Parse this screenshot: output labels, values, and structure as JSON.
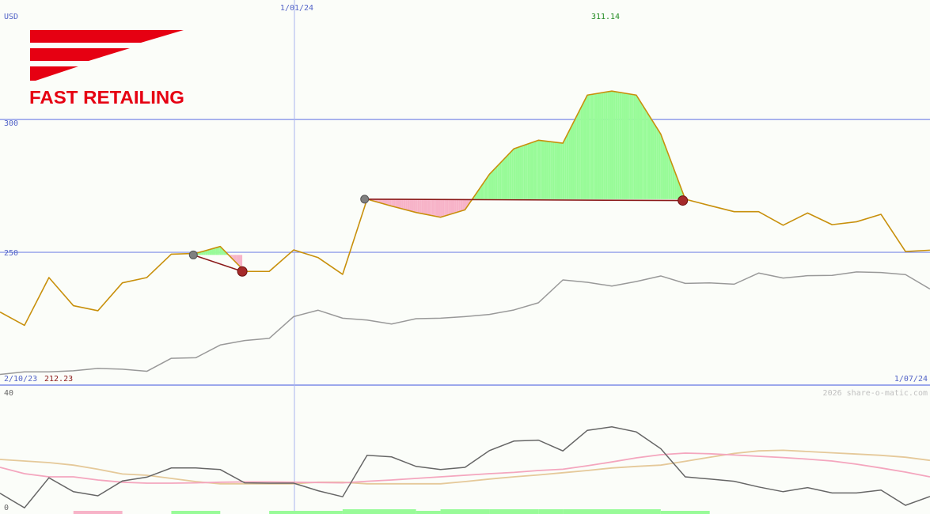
{
  "brand": {
    "name": "FAST RETAILING",
    "color": "#e60012"
  },
  "header": {
    "currency": "USD",
    "date_marker": "1/01/24",
    "high_value": "311.14"
  },
  "footer": {
    "start_date": "2/10/23",
    "low_value": "212.23",
    "end_date": "1/07/24",
    "copyright": "2026 share-o-matic.com"
  },
  "colors": {
    "price_line": "#c8900c",
    "index_line": "#999999",
    "gain_fill": "#98fb98",
    "loss_fill": "#f7b3c8",
    "trade_line": "#8b1a1a",
    "grid": "#7c8ce8",
    "high_label": "#228b22",
    "low_label": "#8b1a1a",
    "osc_main": "#666666",
    "osc_fast": "#f4a6be",
    "osc_slow": "#e5c99a"
  },
  "chart_data": [
    {
      "type": "line",
      "title": "",
      "ylabel": "USD",
      "ylim": [
        200,
        345
      ],
      "yticks": [
        250,
        300
      ],
      "ytick_labels": [
        "250",
        "300"
      ],
      "x_start": "2/10/23",
      "x_end": "1/07/24",
      "x_marker": "1/01/24",
      "grid": true,
      "series": [
        {
          "id": "price",
          "values": [
            227.5,
            222.5,
            240.5,
            229.9,
            228,
            238.5,
            240.5,
            249.3,
            249.6,
            252.2,
            242.8,
            242.8,
            250.9,
            248,
            241.7,
            270,
            267.4,
            265,
            263.2,
            266,
            279.4,
            289,
            292.2,
            291.1,
            309.2,
            310.7,
            309.2,
            294.5,
            270,
            267.6,
            265.3,
            265.3,
            260.2,
            264.8,
            260.4,
            261.5,
            264.3,
            250.3,
            250.8
          ]
        },
        {
          "id": "index",
          "values": [
            204,
            205,
            205,
            205.4,
            206.3,
            206,
            205.2,
            210.1,
            210.3,
            215.1,
            216.8,
            217.6,
            225.8,
            228.2,
            225.2,
            224.5,
            223,
            225,
            225.2,
            225.8,
            226.6,
            228.3,
            231,
            239.6,
            238.7,
            237.3,
            239,
            241.1,
            238.3,
            238.5,
            238,
            242.2,
            240.3,
            241.2,
            241.3,
            242.6,
            242.4,
            241.6,
            236.2
          ]
        }
      ],
      "trades": [
        {
          "entry_index": 7.9,
          "entry_value": 249.0,
          "exit_index": 9.9,
          "exit_value": 242.8
        },
        {
          "entry_index": 14.9,
          "entry_value": 270.0,
          "exit_index": 27.9,
          "exit_value": 269.5
        }
      ],
      "annotations": [
        "311.14",
        "212.23"
      ]
    },
    {
      "type": "line",
      "ylim": [
        0,
        40
      ],
      "ytick_labels": [
        "40",
        "0"
      ],
      "series": [
        {
          "id": "oscillator",
          "values": [
            5.8,
            1.2,
            10.7,
            6.3,
            5,
            9.7,
            10.9,
            13.8,
            13.8,
            13.3,
            9.1,
            9,
            9,
            6.6,
            4.7,
            17.8,
            17.3,
            14.3,
            13.3,
            14,
            19.3,
            22.3,
            22.6,
            19.2,
            25.7,
            26.8,
            25.2,
            19.9,
            11,
            10.3,
            9.6,
            7.8,
            6.3,
            7.6,
            5.9,
            5.9,
            6.8,
            2,
            4.8
          ]
        },
        {
          "id": "fast_average",
          "values": [
            14,
            12,
            11,
            11,
            10,
            9.3,
            9,
            9,
            9.1,
            9.3,
            9.4,
            9.4,
            9.3,
            9.2,
            9.1,
            9.6,
            10,
            10.5,
            11,
            11.5,
            12,
            12.4,
            13,
            13.4,
            14.5,
            15.7,
            17,
            18,
            18.5,
            18.3,
            17.9,
            17.5,
            17.1,
            16.6,
            16,
            15,
            13.8,
            12.5,
            11
          ]
        },
        {
          "id": "slow_average",
          "values": [
            16.5,
            16,
            15.5,
            14.7,
            13.4,
            11.9,
            11.5,
            10.5,
            9.5,
            8.8,
            8.8,
            8.8,
            8.8,
            9.3,
            9.3,
            8.8,
            8.8,
            8.8,
            8.8,
            9.5,
            10.3,
            11,
            11.6,
            12.3,
            13,
            13.8,
            14.3,
            14.7,
            15.9,
            17.2,
            18.4,
            19.2,
            19.4,
            19,
            18.6,
            18.2,
            17.8,
            17.2,
            16.2
          ]
        }
      ],
      "signal_bars": [
        {
          "from": 3,
          "to": 5,
          "state": "loss"
        },
        {
          "from": 7,
          "to": 9,
          "state": "gain"
        },
        {
          "from": 11,
          "to": 14,
          "state": "gain"
        },
        {
          "from": 14,
          "to": 17,
          "state": "gain-strong"
        },
        {
          "from": 17,
          "to": 18,
          "state": "gain"
        },
        {
          "from": 18,
          "to": 20,
          "state": "gain-strong"
        },
        {
          "from": 20,
          "to": 22,
          "state": "gain-strong"
        },
        {
          "from": 22,
          "to": 23,
          "state": "gain-strong"
        },
        {
          "from": 23,
          "to": 25,
          "state": "gain-strong"
        },
        {
          "from": 25,
          "to": 27,
          "state": "gain-strong"
        },
        {
          "from": 27,
          "to": 29,
          "state": "gain"
        }
      ]
    }
  ]
}
